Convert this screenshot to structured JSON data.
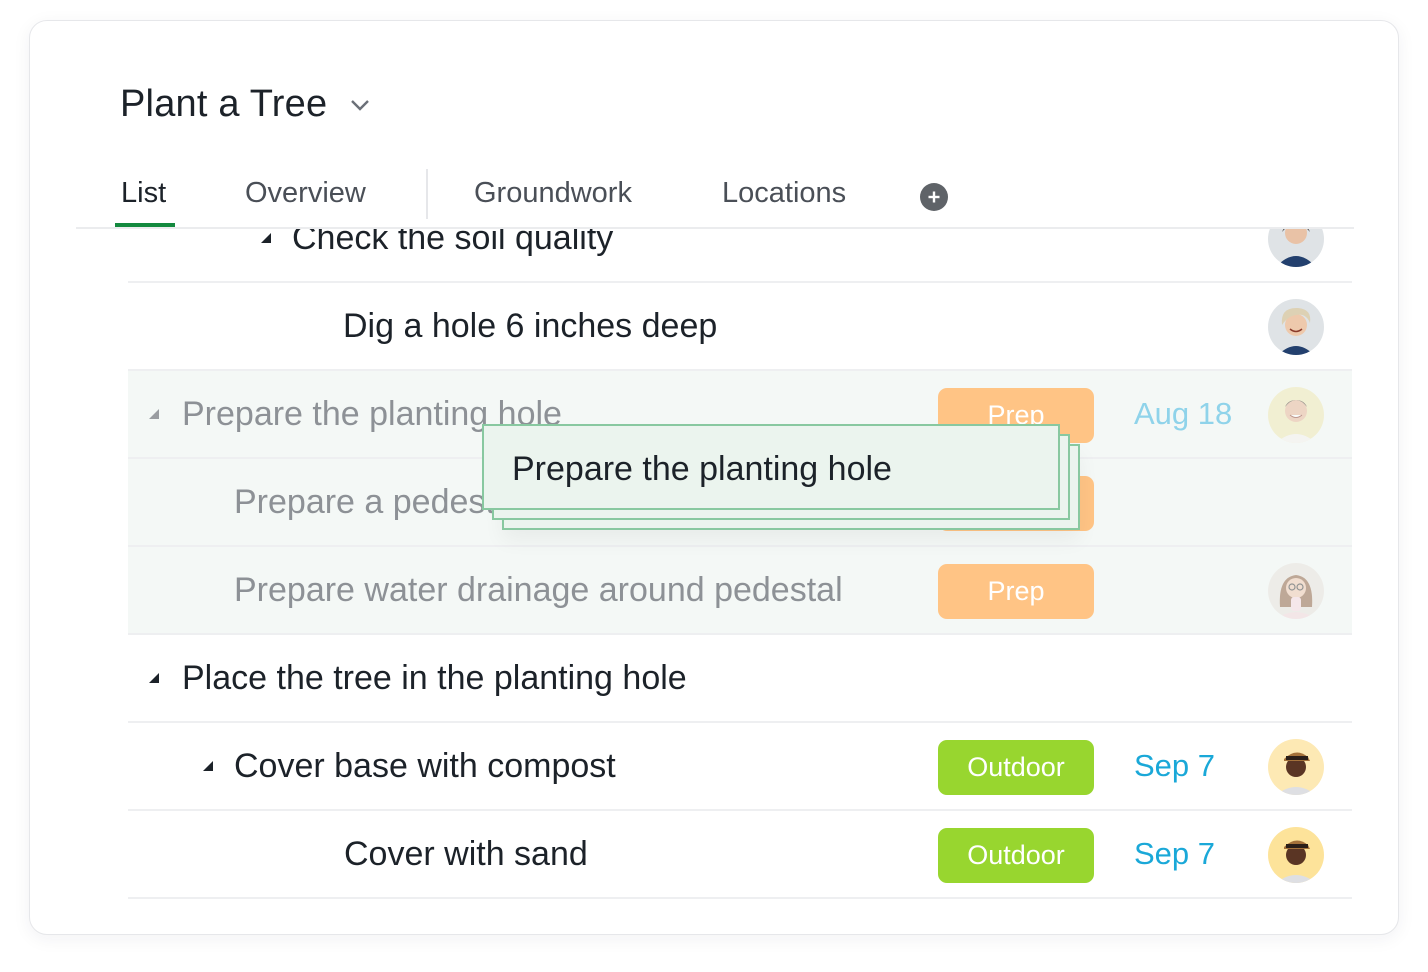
{
  "project": {
    "title": "Plant a Tree",
    "chevron_icon": "chevron-down-icon"
  },
  "tabs": [
    {
      "label": "List",
      "active": true
    },
    {
      "label": "Overview",
      "active": false
    },
    {
      "label": "Groundwork",
      "active": false
    },
    {
      "label": "Locations",
      "active": false
    }
  ],
  "add_tab_icon": "plus-circle-icon",
  "colors": {
    "accent_green": "#13893e",
    "prep_tag": "#ffc485",
    "outdoor_tag": "#98d62f",
    "date_blue": "#1aa8d8"
  },
  "rows": [
    {
      "text": "Check the soil quality",
      "caret": true,
      "tag": null,
      "date": null,
      "avatar": "woman-short-hair"
    },
    {
      "text": "Dig a hole 6 inches deep",
      "caret": false,
      "tag": null,
      "date": null,
      "avatar": "woman-short-blonde"
    },
    {
      "text": "Prepare the planting hole",
      "caret": true,
      "tag": "Prep",
      "date": "Aug 18",
      "avatar": "man-smiling"
    },
    {
      "text": "Prepare a pedestal",
      "caret": false,
      "tag": "Prep",
      "date": null,
      "avatar": null
    },
    {
      "text": "Prepare water drainage around pedestal",
      "caret": false,
      "tag": "Prep",
      "date": null,
      "avatar": "woman-glasses"
    },
    {
      "text": "Place the tree in the planting hole",
      "caret": true,
      "tag": null,
      "date": null,
      "avatar": null
    },
    {
      "text": "Cover base with compost",
      "caret": true,
      "tag": "Outdoor",
      "date": "Sep 7",
      "avatar": "man-cap"
    },
    {
      "text": "Cover with sand",
      "caret": false,
      "tag": "Outdoor",
      "date": "Sep 7",
      "avatar": "man-cap"
    }
  ],
  "drag_ghost": {
    "text": "Prepare the planting hole"
  }
}
